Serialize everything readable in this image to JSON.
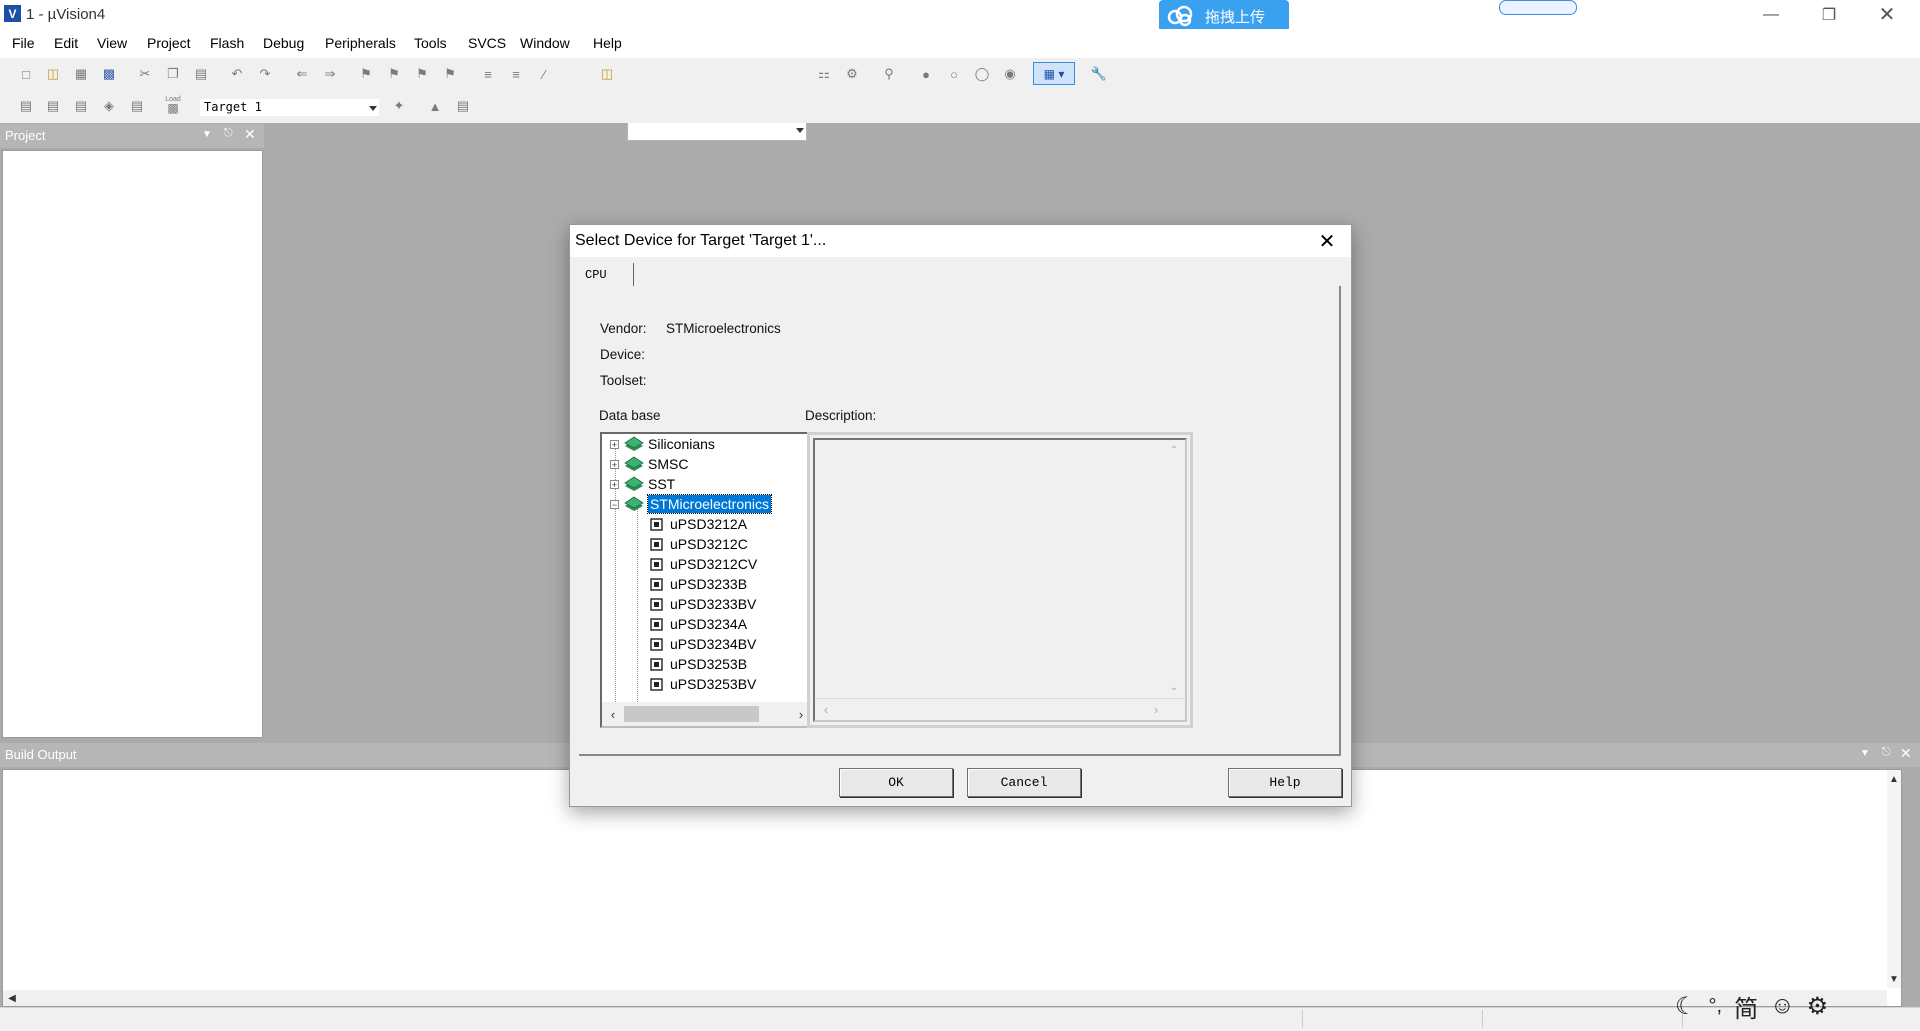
{
  "window": {
    "title": "1 - µVision4",
    "upload_badge": "拖拽上传"
  },
  "menu": [
    "File",
    "Edit",
    "View",
    "Project",
    "Flash",
    "Debug",
    "Peripherals",
    "Tools",
    "SVCS",
    "Window",
    "Help"
  ],
  "toolbar": {
    "target_select": "Target 1",
    "load_label": "Load"
  },
  "project_panel": {
    "title": "Project"
  },
  "build_panel": {
    "title": "Build Output"
  },
  "dialog": {
    "title": "Select Device for Target 'Target 1'...",
    "tab": "CPU",
    "vendor_label": "Vendor:",
    "vendor_value": "STMicroelectronics",
    "device_label": "Device:",
    "toolset_label": "Toolset:",
    "database_label": "Data base",
    "description_label": "Description:",
    "tree": {
      "vendors": [
        "Siliconians",
        "SMSC",
        "SST",
        "STMicroelectronics"
      ],
      "selected_vendor": "STMicroelectronics",
      "devices": [
        "uPSD3212A",
        "uPSD3212C",
        "uPSD3212CV",
        "uPSD3233B",
        "uPSD3233BV",
        "uPSD3234A",
        "uPSD3234BV",
        "uPSD3253B",
        "uPSD3253BV"
      ]
    },
    "buttons": {
      "ok": "OK",
      "cancel": "Cancel",
      "help": "Help"
    }
  },
  "taskbar": {
    "ime_label": "简"
  },
  "colors": {
    "selection": "#0078d7",
    "panel_header": "#b6b6b6",
    "upload_badge": "#3aa0f0"
  }
}
